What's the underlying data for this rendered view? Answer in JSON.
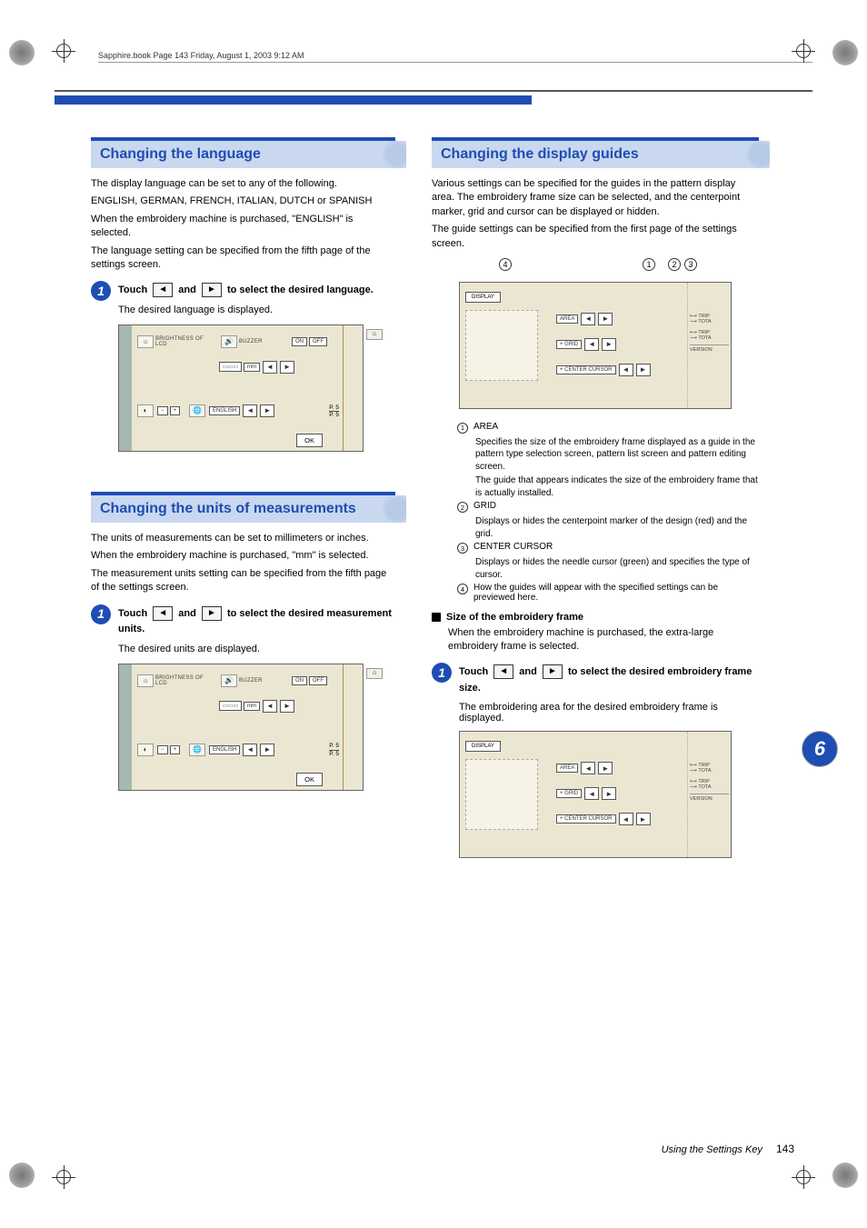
{
  "book_header": "Sapphire.book  Page 143  Friday, August 1, 2003  9:12 AM",
  "left": {
    "sec1": {
      "title": "Changing the language",
      "p1": "The display language can be set to any of the following.",
      "p2": "ENGLISH, GERMAN, FRENCH, ITALIAN, DUTCH or SPANISH",
      "p3": "When the embroidery machine is purchased, \"ENGLISH\" is selected.",
      "p4": "The language setting can be specified from the fifth page of the settings screen.",
      "step1_num": "1",
      "step1_a": "Touch ",
      "step1_b": " and ",
      "step1_c": " to select the desired language.",
      "step1_detail": "The desired language is displayed."
    },
    "sec2": {
      "title": "Changing the units of measurements",
      "p1": "The units of measurements can be set to millimeters or inches.",
      "p2": "When the embroidery machine is purchased, \"mm\" is selected.",
      "p3": "The measurement units setting can be specified from the fifth page of the settings screen.",
      "step1_num": "1",
      "step1_a": "Touch ",
      "step1_b": " and ",
      "step1_c": " to select the desired measurement units.",
      "step1_detail": "The desired units are displayed."
    },
    "screen": {
      "brightness": "BRIGHTNESS OF LCD",
      "buzzer": "BUZZER",
      "on": "ON",
      "off": "OFF",
      "mm": "mm",
      "english": "ENGLISH",
      "ok": "OK",
      "page_top": "P.  5",
      "page_bot": "P.  5",
      "minus": "−",
      "plus": "+"
    }
  },
  "right": {
    "sec1": {
      "title": "Changing the display guides",
      "p1": "Various settings can be specified for the guides in the pattern display area. The embroidery frame size can be selected, and the centerpoint marker, grid and cursor can be displayed or hidden.",
      "p2": "The guide settings can be specified from the first page of the settings screen.",
      "labels": {
        "n1": "1",
        "n2": "2",
        "n3": "3",
        "n4": "4"
      },
      "panel": {
        "display": "DISPLAY",
        "area": "AREA",
        "grid": "GRID",
        "center": "CENTER CURSOR",
        "trip": "TRIP",
        "tota": "TOTA",
        "version": "VERSION"
      },
      "legend": {
        "l1_head": "AREA",
        "l1_body1": "Specifies the size of the embroidery frame displayed as a guide in the pattern type selection screen, pattern list screen and pattern editing screen.",
        "l1_body2": "The guide that appears indicates the size of the embroidery frame that is actually installed.",
        "l2_head": "GRID",
        "l2_body1": "Displays or hides the centerpoint marker of the design (red) and the grid.",
        "l3_head": "CENTER CURSOR",
        "l3_body1": "Displays or hides the needle cursor (green) and specifies the type of cursor.",
        "l4_head": "How the guides will appear with the specified settings can be previewed here."
      },
      "sub_heading": "Size of the embroidery frame",
      "sub_body": "When the embroidery machine is purchased, the extra-large embroidery frame is selected.",
      "step1_num": "1",
      "step1_a": "Touch ",
      "step1_b": " and ",
      "step1_c": " to select the desired embroidery frame size.",
      "step1_detail": "The embroidering area for the desired embroidery frame is displayed."
    }
  },
  "chapter_tab": "6",
  "footer": {
    "book": "Using the Settings Key",
    "page": "143"
  },
  "glyph": {
    "left": "◄",
    "right": "►"
  }
}
